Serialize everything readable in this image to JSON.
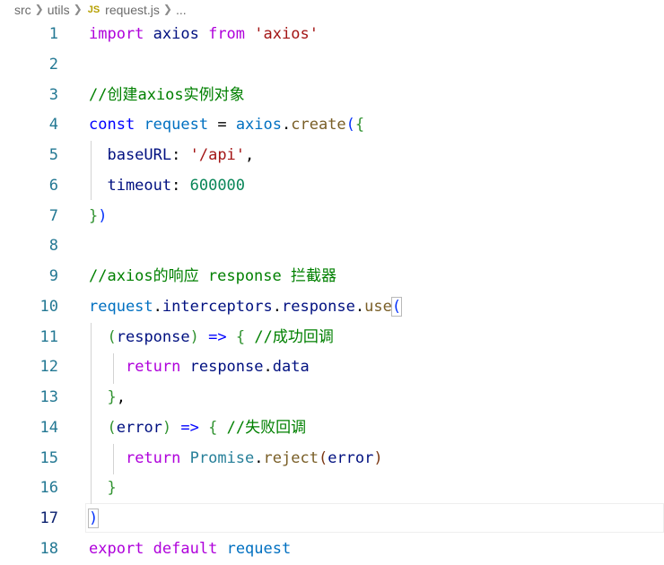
{
  "breadcrumb": {
    "items": [
      "src",
      "utils"
    ],
    "file_icon": "JS",
    "file_name": "request.js",
    "ellipsis": "..."
  },
  "editor": {
    "lines": [
      {
        "number": "1",
        "tokens": [
          [
            "import",
            "kw"
          ],
          [
            " axios ",
            "vardark"
          ],
          [
            "from",
            "kw"
          ],
          [
            " ",
            "op"
          ],
          [
            "'axios'",
            "str"
          ]
        ]
      },
      {
        "number": "2",
        "tokens": []
      },
      {
        "number": "3",
        "tokens": [
          [
            "//创建axios实例对象",
            "cmt"
          ]
        ]
      },
      {
        "number": "4",
        "tokens": [
          [
            "const",
            "decl"
          ],
          [
            " ",
            "op"
          ],
          [
            "request",
            "var"
          ],
          [
            " = ",
            "op"
          ],
          [
            "axios",
            "var"
          ],
          [
            ".",
            "op"
          ],
          [
            "create",
            "fn"
          ],
          [
            "(",
            "p1"
          ],
          [
            "{",
            "p2"
          ]
        ]
      },
      {
        "number": "5",
        "tokens": [
          [
            "  baseURL",
            "vardark"
          ],
          [
            ": ",
            "op"
          ],
          [
            "'/api'",
            "str"
          ],
          [
            ",",
            "op"
          ]
        ]
      },
      {
        "number": "6",
        "tokens": [
          [
            "  timeout",
            "vardark"
          ],
          [
            ": ",
            "op"
          ],
          [
            "600000",
            "num"
          ]
        ]
      },
      {
        "number": "7",
        "tokens": [
          [
            "}",
            "p2"
          ],
          [
            ")",
            "p1"
          ]
        ]
      },
      {
        "number": "8",
        "tokens": []
      },
      {
        "number": "9",
        "tokens": [
          [
            "//axios的响应 response 拦截器",
            "cmt"
          ]
        ]
      },
      {
        "number": "10",
        "tokens": [
          [
            "request",
            "var"
          ],
          [
            ".",
            "op"
          ],
          [
            "interceptors",
            "vardark"
          ],
          [
            ".",
            "op"
          ],
          [
            "response",
            "vardark"
          ],
          [
            ".",
            "op"
          ],
          [
            "use",
            "fn"
          ],
          [
            "(",
            "p1 brk-match"
          ]
        ]
      },
      {
        "number": "11",
        "tokens": [
          [
            "  ",
            "op"
          ],
          [
            "(",
            "p2"
          ],
          [
            "response",
            "vardark"
          ],
          [
            ")",
            "p2"
          ],
          [
            " ",
            "op"
          ],
          [
            "=>",
            "decl"
          ],
          [
            " ",
            "op"
          ],
          [
            "{",
            "p2"
          ],
          [
            " ",
            "op"
          ],
          [
            "//成功回调",
            "cmt"
          ]
        ]
      },
      {
        "number": "12",
        "tokens": [
          [
            "    ",
            "op"
          ],
          [
            "return",
            "kw"
          ],
          [
            " response",
            "vardark"
          ],
          [
            ".",
            "op"
          ],
          [
            "data",
            "vardark"
          ]
        ]
      },
      {
        "number": "13",
        "tokens": [
          [
            "  ",
            "op"
          ],
          [
            "}",
            "p2"
          ],
          [
            ",",
            "op"
          ]
        ]
      },
      {
        "number": "14",
        "tokens": [
          [
            "  ",
            "op"
          ],
          [
            "(",
            "p2"
          ],
          [
            "error",
            "vardark"
          ],
          [
            ")",
            "p2"
          ],
          [
            " ",
            "op"
          ],
          [
            "=>",
            "decl"
          ],
          [
            " ",
            "op"
          ],
          [
            "{",
            "p2"
          ],
          [
            " ",
            "op"
          ],
          [
            "//失败回调",
            "cmt"
          ]
        ]
      },
      {
        "number": "15",
        "tokens": [
          [
            "    ",
            "op"
          ],
          [
            "return",
            "kw"
          ],
          [
            " ",
            "op"
          ],
          [
            "Promise",
            "cls"
          ],
          [
            ".",
            "op"
          ],
          [
            "reject",
            "fn"
          ],
          [
            "(",
            "p3"
          ],
          [
            "error",
            "vardark"
          ],
          [
            ")",
            "p3"
          ]
        ]
      },
      {
        "number": "16",
        "tokens": [
          [
            "  ",
            "op"
          ],
          [
            "}",
            "p2"
          ]
        ]
      },
      {
        "number": "17",
        "tokens": [
          [
            ")",
            "p1 brk-match"
          ]
        ],
        "active": true
      },
      {
        "number": "18",
        "tokens": [
          [
            "export",
            "kw"
          ],
          [
            " ",
            "op"
          ],
          [
            "default",
            "kw"
          ],
          [
            " ",
            "op"
          ],
          [
            "request",
            "var"
          ]
        ]
      }
    ]
  }
}
